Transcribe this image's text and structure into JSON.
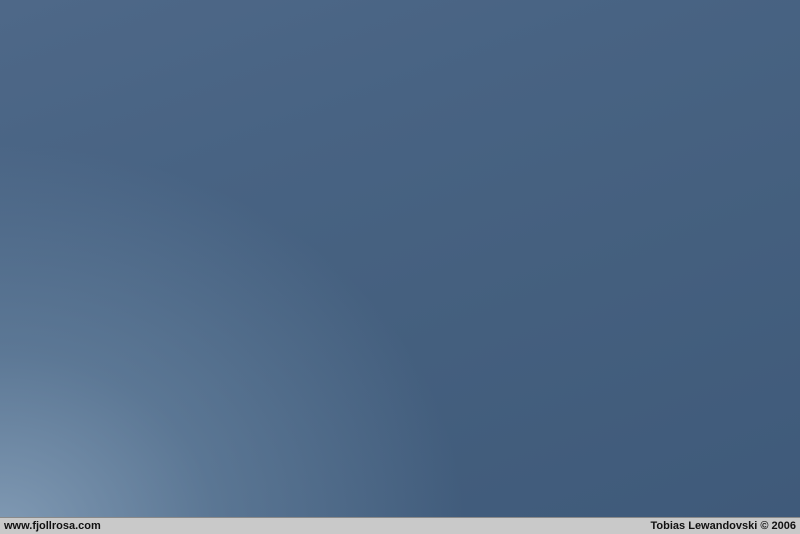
{
  "caption": {
    "website": "www.fjollrosa.com",
    "credit": "Tobias Lewandovski © 2006"
  },
  "colors": {
    "sky_top_right": "#3f5a7a",
    "sky_bottom_left": "#8ca5be",
    "caption_bar": "#c9c9c9"
  }
}
